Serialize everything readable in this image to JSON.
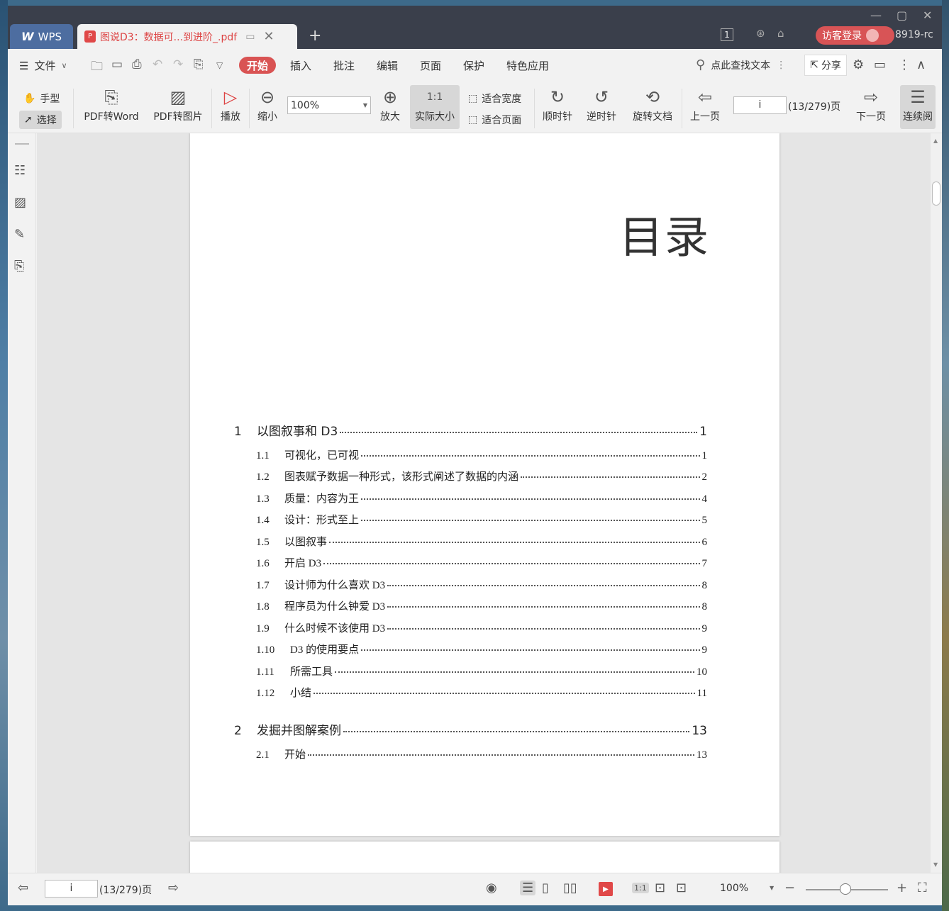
{
  "titlebar": {
    "app_tab": "WPS",
    "doc_tab_title": "图说D3：数据可...到进阶_.pdf",
    "tab_count": "1",
    "login_label": "访客登录",
    "user_id": "8919-rc"
  },
  "menubar": {
    "file_label": "文件",
    "tabs": [
      "开始",
      "插入",
      "批注",
      "编辑",
      "页面",
      "保护",
      "特色应用"
    ],
    "search_label": "点此查找文本",
    "share_label": "分享"
  },
  "ribbon": {
    "hand_label": "手型",
    "select_label": "选择",
    "pdf_to_word": "PDF转Word",
    "pdf_to_image": "PDF转图片",
    "play_label": "播放",
    "zoom_out_label": "缩小",
    "zoom_value": "100%",
    "zoom_in_label": "放大",
    "actual_size_label": "实际大小",
    "fit_width_label": "适合宽度",
    "fit_page_label": "适合页面",
    "clockwise_label": "顺时针",
    "counter_label": "逆时针",
    "rotate_doc_label": "旋转文档",
    "prev_label": "上一页",
    "page_value": "i",
    "page_count": "(13/279)页",
    "next_label": "下一页",
    "continuous_label": "连续阅"
  },
  "document": {
    "heading": "目录",
    "chapters": [
      {
        "num": "1",
        "title": "以图叙事和 D3",
        "page": "1"
      },
      {
        "num": "2",
        "title": "发掘并图解案例",
        "page": "13"
      }
    ],
    "sections": [
      {
        "num": "1.1",
        "title": "可视化，已可视",
        "page": "1"
      },
      {
        "num": "1.2",
        "title": "图表赋予数据一种形式，该形式阐述了数据的内涵",
        "page": "2"
      },
      {
        "num": "1.3",
        "title": "质量：内容为王",
        "page": "4"
      },
      {
        "num": "1.4",
        "title": "设计：形式至上",
        "page": "5"
      },
      {
        "num": "1.5",
        "title": "以图叙事",
        "page": "6"
      },
      {
        "num": "1.6",
        "title": "开启 D3",
        "page": "7"
      },
      {
        "num": "1.7",
        "title": "设计师为什么喜欢 D3",
        "page": "8"
      },
      {
        "num": "1.8",
        "title": "程序员为什么钟爱 D3",
        "page": "8"
      },
      {
        "num": "1.9",
        "title": "什么时候不该使用 D3",
        "page": "9"
      },
      {
        "num": "1.10",
        "title": "D3 的使用要点",
        "page": "9"
      },
      {
        "num": "1.11",
        "title": "所需工具",
        "page": "10"
      },
      {
        "num": "1.12",
        "title": "小结",
        "page": "11"
      },
      {
        "num": "2.1",
        "title": "开始",
        "page": "13"
      }
    ]
  },
  "statusbar": {
    "page_value": "i",
    "page_count": "(13/279)页",
    "zoom_value": "100%"
  }
}
